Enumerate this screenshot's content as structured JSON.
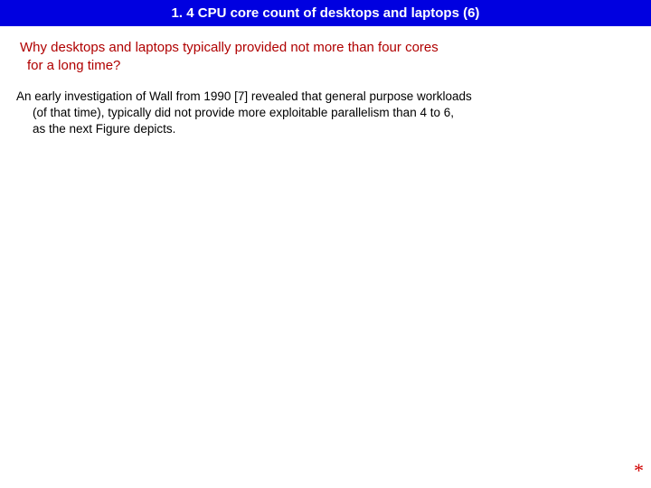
{
  "title": "1. 4 CPU core count of desktops and laptops (6)",
  "subheading_line1": "Why desktops and laptops typically provided not more  than four cores",
  "subheading_line2": "for a long time?",
  "body_line1": "An early investigation of Wall from 1990 [7] revealed that general purpose workloads",
  "body_line2": "(of that time), typically did not provide more exploitable parallelism than 4 to 6,",
  "body_line3": "as the next Figure depicts.",
  "asterisk": "*"
}
